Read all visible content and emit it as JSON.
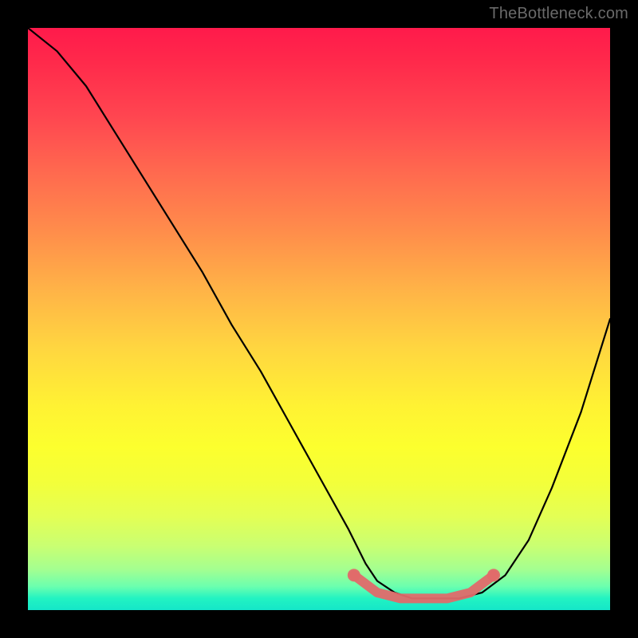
{
  "watermark": "TheBottleneck.com",
  "colors": {
    "frame": "#000000",
    "curve": "#000000",
    "marker": "#e06a6a"
  },
  "chart_data": {
    "type": "line",
    "title": "",
    "xlabel": "",
    "ylabel": "",
    "xlim": [
      0,
      100
    ],
    "ylim": [
      0,
      100
    ],
    "grid": false,
    "legend": null,
    "series": [
      {
        "name": "bottleneck-curve",
        "x": [
          0,
          5,
          10,
          15,
          20,
          25,
          30,
          35,
          40,
          45,
          50,
          55,
          58,
          60,
          63,
          66,
          70,
          74,
          78,
          82,
          86,
          90,
          95,
          100
        ],
        "y": [
          100,
          96,
          90,
          82,
          74,
          66,
          58,
          49,
          41,
          32,
          23,
          14,
          8,
          5,
          3,
          2,
          2,
          2,
          3,
          6,
          12,
          21,
          34,
          50
        ]
      }
    ],
    "annotations": [
      {
        "name": "optimal-range",
        "x": [
          56,
          60,
          64,
          68,
          72,
          76,
          80
        ],
        "y": [
          6,
          3,
          2,
          2,
          2,
          3,
          6
        ]
      }
    ]
  }
}
